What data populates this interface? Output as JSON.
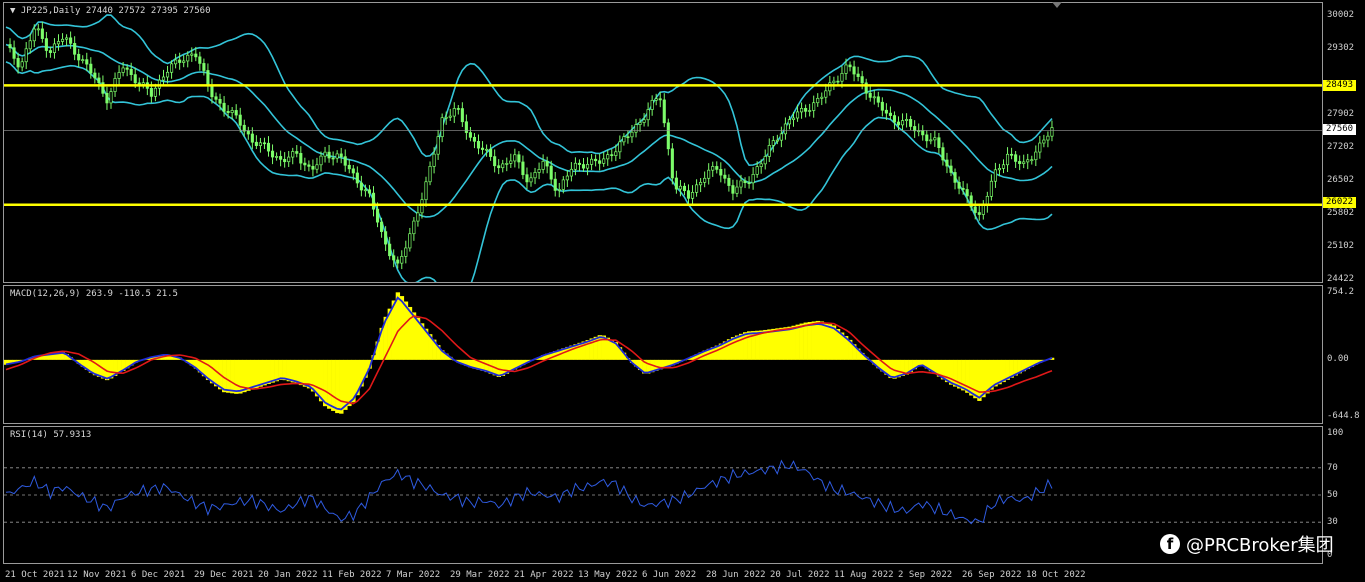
{
  "price_pane": {
    "title": "▼ JP225,Daily  27440 27572 27395 27560",
    "y_labels": [
      "30002",
      "29302",
      "28493",
      "27902",
      "27560",
      "27202",
      "26502",
      "26022",
      "25802",
      "25102",
      "24422"
    ],
    "current_price": "27560",
    "resistance": "28493",
    "support": "26022",
    "colors": {
      "candles": "#7CFC6A",
      "bands": "#33C4D8",
      "levels": "#FFFF00"
    }
  },
  "macd_pane": {
    "title": "MACD(12,26,9) 263.9 -110.5 21.5",
    "y_labels": [
      "754.2",
      "0.00",
      "-644.8"
    ],
    "colors": {
      "histogram": "#FFFF00",
      "macd": "#1F2BD8",
      "signal": "#E01818"
    }
  },
  "rsi_pane": {
    "title": "RSI(14) 57.9313",
    "y_labels": [
      "100",
      "70",
      "50",
      "30",
      "0"
    ],
    "colors": {
      "line": "#2F5BE0",
      "levels": "#9a9a9a"
    }
  },
  "x_labels": [
    "21 Oct 2021",
    "12 Nov 2021",
    "6 Dec 2021",
    "29 Dec 2021",
    "20 Jan 2022",
    "11 Feb 2022",
    "7 Mar 2022",
    "29 Mar 2022",
    "21 Apr 2022",
    "13 May 2022",
    "6 Jun 2022",
    "28 Jun 2022",
    "20 Jul 2022",
    "11 Aug 2022",
    "2 Sep 2022",
    "26 Sep 2022",
    "18 Oct 2022"
  ],
  "watermark": {
    "text": "@PRCBroker集团",
    "icon": "facebook-icon"
  },
  "chart_data": [
    {
      "type": "line",
      "title": "JP225,Daily",
      "series": [
        {
          "name": "JP225",
          "values": [
            29300,
            28900,
            29700,
            29200,
            29500,
            29100,
            28700,
            28200,
            28900,
            28600,
            28300,
            28800,
            29000,
            29200,
            28400,
            28000,
            27800,
            27300,
            27200,
            26900,
            27100,
            26700,
            27100,
            27000,
            26600,
            26200,
            25300,
            24700,
            25600,
            26500,
            27800,
            28000,
            27400,
            27100,
            26800,
            27000,
            26500,
            26900,
            26300,
            26800,
            26900,
            26900,
            27200,
            27500,
            27900,
            28300,
            26400,
            26200,
            26600,
            26800,
            26300,
            26500,
            26900,
            27400,
            27800,
            28000,
            28200,
            28600,
            28900,
            28500,
            28100,
            27800,
            27700,
            27500,
            27300,
            26700,
            26200,
            25800,
            26600,
            27100,
            26800,
            27200,
            27560
          ]
        }
      ],
      "resistance": 28493,
      "support": 26022,
      "ylim": [
        24422,
        30200
      ]
    },
    {
      "type": "bar",
      "title": "MACD(12,26,9)",
      "series": [
        {
          "name": "MACD",
          "values": [
            -50,
            -20,
            40,
            60,
            80,
            -40,
            -150,
            -210,
            -120,
            -20,
            30,
            60,
            20,
            -80,
            -220,
            -330,
            -350,
            -300,
            -250,
            -200,
            -240,
            -300,
            -480,
            -560,
            -420,
            -100,
            400,
            700,
            500,
            300,
            100,
            -20,
            -80,
            -120,
            -180,
            -100,
            -20,
            50,
            100,
            150,
            200,
            260,
            180,
            -20,
            -150,
            -100,
            -50,
            20,
            90,
            150,
            230,
            290,
            300,
            320,
            340,
            380,
            400,
            350,
            220,
            60,
            -80,
            -200,
            -150,
            -50,
            -150,
            -250,
            -320,
            -420,
            -280,
            -200,
            -120,
            -40,
            21.5
          ]
        },
        {
          "name": "Signal",
          "values": [
            -100,
            -50,
            20,
            70,
            90,
            60,
            -20,
            -120,
            -140,
            -80,
            0,
            40,
            50,
            20,
            -60,
            -180,
            -270,
            -300,
            -280,
            -250,
            -240,
            -250,
            -320,
            -420,
            -450,
            -300,
            0,
            300,
            450,
            420,
            300,
            150,
            20,
            -40,
            -100,
            -120,
            -80,
            -10,
            50,
            110,
            160,
            210,
            200,
            100,
            -30,
            -80,
            -80,
            -30,
            40,
            100,
            170,
            230,
            270,
            300,
            320,
            350,
            380,
            370,
            290,
            150,
            20,
            -100,
            -140,
            -120,
            -140,
            -190,
            -260,
            -330,
            -320,
            -280,
            -220,
            -170,
            -110.5
          ]
        }
      ],
      "ylim": [
        -644.8,
        754.2
      ]
    },
    {
      "type": "line",
      "title": "RSI(14)",
      "series": [
        {
          "name": "RSI",
          "values": [
            50,
            55,
            60,
            52,
            56,
            50,
            45,
            40,
            48,
            52,
            54,
            56,
            50,
            44,
            40,
            42,
            45,
            46,
            42,
            38,
            44,
            48,
            40,
            32,
            36,
            48,
            60,
            66,
            60,
            56,
            50,
            48,
            44,
            46,
            42,
            48,
            52,
            50,
            48,
            54,
            56,
            60,
            58,
            48,
            42,
            44,
            46,
            50,
            56,
            60,
            64,
            66,
            68,
            70,
            72,
            68,
            60,
            54,
            52,
            48,
            44,
            40,
            38,
            44,
            40,
            36,
            32,
            30,
            44,
            48,
            46,
            52,
            57.9313
          ]
        }
      ],
      "ylim": [
        0,
        100
      ]
    }
  ]
}
